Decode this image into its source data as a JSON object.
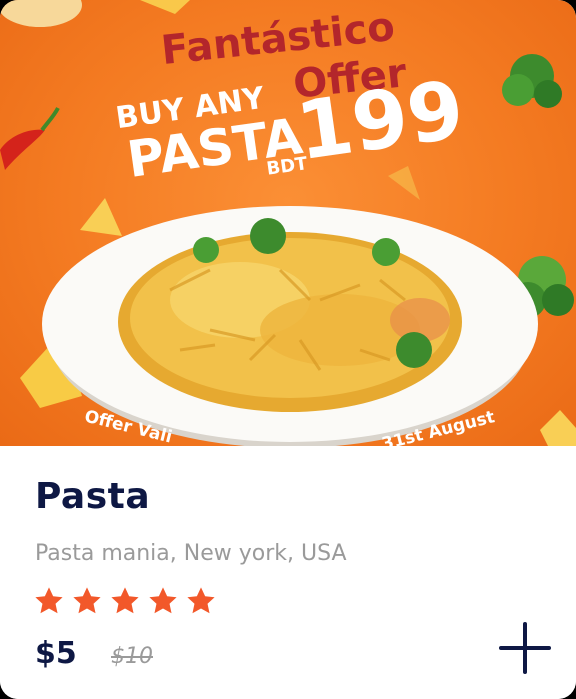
{
  "banner": {
    "headline": "Fantástico",
    "headline2": "Offer",
    "line1": "BUY ANY",
    "line2": "PASTA",
    "currency": "BDT",
    "amount": "199",
    "footer_left": "Offer Vali",
    "footer_right": "31st August"
  },
  "product": {
    "name": "Pasta",
    "location": "Pasta mania, New york, USA",
    "rating": 5,
    "rating_max": 5,
    "price": "$5",
    "old_price": "$10"
  },
  "icons": {
    "star": "star-icon",
    "add": "plus-icon"
  },
  "colors": {
    "banner_orange": "#f47b22",
    "headline_red": "#b3262b",
    "star_orange": "#f2582a",
    "title_navy": "#0e1844",
    "muted_gray": "#9a9a9a"
  }
}
